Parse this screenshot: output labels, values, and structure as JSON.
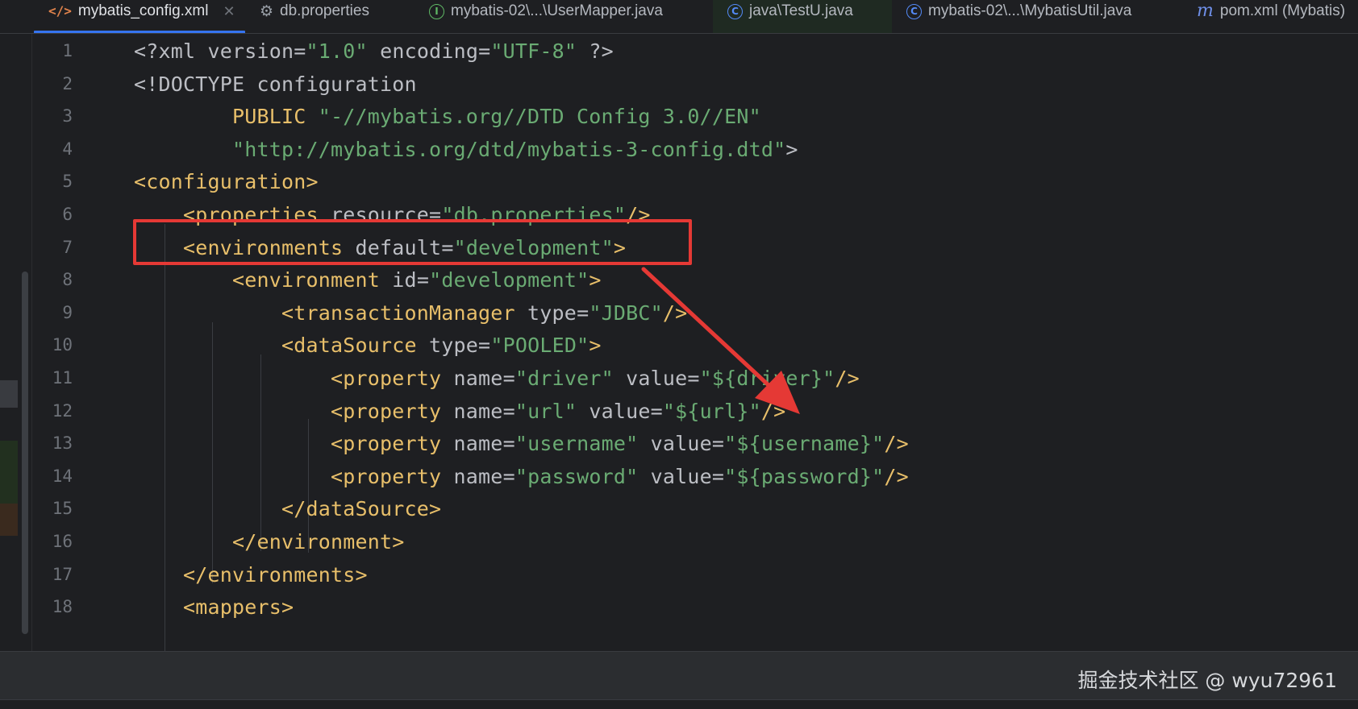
{
  "tabs": [
    {
      "label": "mybatis_config.xml",
      "icon": "xml-file-icon",
      "active": true,
      "closable": true
    },
    {
      "label": "db.properties",
      "icon": "gear-file-icon"
    },
    {
      "label": "mybatis-02\\...\\UserMapper.java",
      "icon": "interface-icon"
    },
    {
      "label": "java\\TestU.java",
      "icon": "class-icon"
    },
    {
      "label": "mybatis-02\\...\\MybatisUtil.java",
      "icon": "class-icon"
    },
    {
      "label": "pom.xml (Mybatis)",
      "icon": "maven-icon"
    }
  ],
  "editor": {
    "line_numbers": [
      "1",
      "2",
      "3",
      "4",
      "5",
      "6",
      "7",
      "8",
      "9",
      "10",
      "11",
      "12",
      "13",
      "14",
      "15",
      "16",
      "17",
      "18"
    ],
    "lines": [
      [
        {
          "t": "pl",
          "s": "<?xml "
        },
        {
          "t": "attr",
          "s": "version"
        },
        {
          "t": "eq",
          "s": "="
        },
        {
          "t": "val",
          "s": "\"1.0\""
        },
        {
          "t": "pl",
          "s": " "
        },
        {
          "t": "attr",
          "s": "encoding"
        },
        {
          "t": "eq",
          "s": "="
        },
        {
          "t": "val",
          "s": "\"UTF-8\""
        },
        {
          "t": "pl",
          "s": " ?>"
        }
      ],
      [
        {
          "t": "pl",
          "s": "<!DOCTYPE configuration"
        }
      ],
      [
        {
          "t": "pl",
          "s": "        "
        },
        {
          "t": "tag",
          "s": "PUBLIC "
        },
        {
          "t": "val",
          "s": "\"-//mybatis.org//DTD Config 3.0//EN\""
        }
      ],
      [
        {
          "t": "pl",
          "s": "        "
        },
        {
          "t": "val",
          "s": "\"http://mybatis.org/dtd/mybatis-3-config.dtd\""
        },
        {
          "t": "pl",
          "s": ">"
        }
      ],
      [
        {
          "t": "tag",
          "s": "<configuration>"
        }
      ],
      [
        {
          "t": "pl",
          "s": "    "
        },
        {
          "t": "tag",
          "s": "<properties "
        },
        {
          "t": "attr",
          "s": "resource"
        },
        {
          "t": "eq",
          "s": "="
        },
        {
          "t": "val",
          "s": "\"db.properties\""
        },
        {
          "t": "tag",
          "s": "/>"
        }
      ],
      [
        {
          "t": "pl",
          "s": "    "
        },
        {
          "t": "tag",
          "s": "<environments "
        },
        {
          "t": "attr",
          "s": "default"
        },
        {
          "t": "eq",
          "s": "="
        },
        {
          "t": "val",
          "s": "\"development\""
        },
        {
          "t": "tag",
          "s": ">"
        }
      ],
      [
        {
          "t": "pl",
          "s": "        "
        },
        {
          "t": "tag",
          "s": "<environment "
        },
        {
          "t": "attr",
          "s": "id"
        },
        {
          "t": "eq",
          "s": "="
        },
        {
          "t": "val",
          "s": "\"development\""
        },
        {
          "t": "tag",
          "s": ">"
        }
      ],
      [
        {
          "t": "pl",
          "s": "            "
        },
        {
          "t": "tag",
          "s": "<transactionManager "
        },
        {
          "t": "attr",
          "s": "type"
        },
        {
          "t": "eq",
          "s": "="
        },
        {
          "t": "val",
          "s": "\"JDBC\""
        },
        {
          "t": "tag",
          "s": "/>"
        }
      ],
      [
        {
          "t": "pl",
          "s": "            "
        },
        {
          "t": "tag",
          "s": "<dataSource "
        },
        {
          "t": "attr",
          "s": "type"
        },
        {
          "t": "eq",
          "s": "="
        },
        {
          "t": "val",
          "s": "\"POOLED\""
        },
        {
          "t": "tag",
          "s": ">"
        }
      ],
      [
        {
          "t": "pl",
          "s": "                "
        },
        {
          "t": "tag",
          "s": "<property "
        },
        {
          "t": "attr",
          "s": "name"
        },
        {
          "t": "eq",
          "s": "="
        },
        {
          "t": "val",
          "s": "\"driver\""
        },
        {
          "t": "pl",
          "s": " "
        },
        {
          "t": "attr",
          "s": "value"
        },
        {
          "t": "eq",
          "s": "="
        },
        {
          "t": "val",
          "s": "\"${driver}\""
        },
        {
          "t": "tag",
          "s": "/>"
        }
      ],
      [
        {
          "t": "pl",
          "s": "                "
        },
        {
          "t": "tag",
          "s": "<property "
        },
        {
          "t": "attr",
          "s": "name"
        },
        {
          "t": "eq",
          "s": "="
        },
        {
          "t": "val",
          "s": "\"url\""
        },
        {
          "t": "pl",
          "s": " "
        },
        {
          "t": "attr",
          "s": "value"
        },
        {
          "t": "eq",
          "s": "="
        },
        {
          "t": "val",
          "s": "\"${url}\""
        },
        {
          "t": "tag",
          "s": "/>"
        }
      ],
      [
        {
          "t": "pl",
          "s": "                "
        },
        {
          "t": "tag",
          "s": "<property "
        },
        {
          "t": "attr",
          "s": "name"
        },
        {
          "t": "eq",
          "s": "="
        },
        {
          "t": "val",
          "s": "\"username\""
        },
        {
          "t": "pl",
          "s": " "
        },
        {
          "t": "attr",
          "s": "value"
        },
        {
          "t": "eq",
          "s": "="
        },
        {
          "t": "val",
          "s": "\"${username}\""
        },
        {
          "t": "tag",
          "s": "/>"
        }
      ],
      [
        {
          "t": "pl",
          "s": "                "
        },
        {
          "t": "tag",
          "s": "<property "
        },
        {
          "t": "attr",
          "s": "name"
        },
        {
          "t": "eq",
          "s": "="
        },
        {
          "t": "val",
          "s": "\"password\""
        },
        {
          "t": "pl",
          "s": " "
        },
        {
          "t": "attr",
          "s": "value"
        },
        {
          "t": "eq",
          "s": "="
        },
        {
          "t": "val",
          "s": "\"${password}\""
        },
        {
          "t": "tag",
          "s": "/>"
        }
      ],
      [
        {
          "t": "pl",
          "s": "            "
        },
        {
          "t": "tag",
          "s": "</dataSource>"
        }
      ],
      [
        {
          "t": "pl",
          "s": "        "
        },
        {
          "t": "tag",
          "s": "</environment>"
        }
      ],
      [
        {
          "t": "pl",
          "s": "    "
        },
        {
          "t": "tag",
          "s": "</environments>"
        }
      ],
      [
        {
          "t": "pl",
          "s": "    "
        },
        {
          "t": "tag",
          "s": "<mappers>"
        }
      ]
    ]
  },
  "annotation": {
    "color": "#e53935"
  },
  "colors": {
    "tag": "#e8bf6a",
    "attr": "#bcbec4",
    "value": "#6aab73",
    "active_tab_underline": "#3574f0"
  },
  "watermark": "掘金技术社区 @ wyu72961"
}
